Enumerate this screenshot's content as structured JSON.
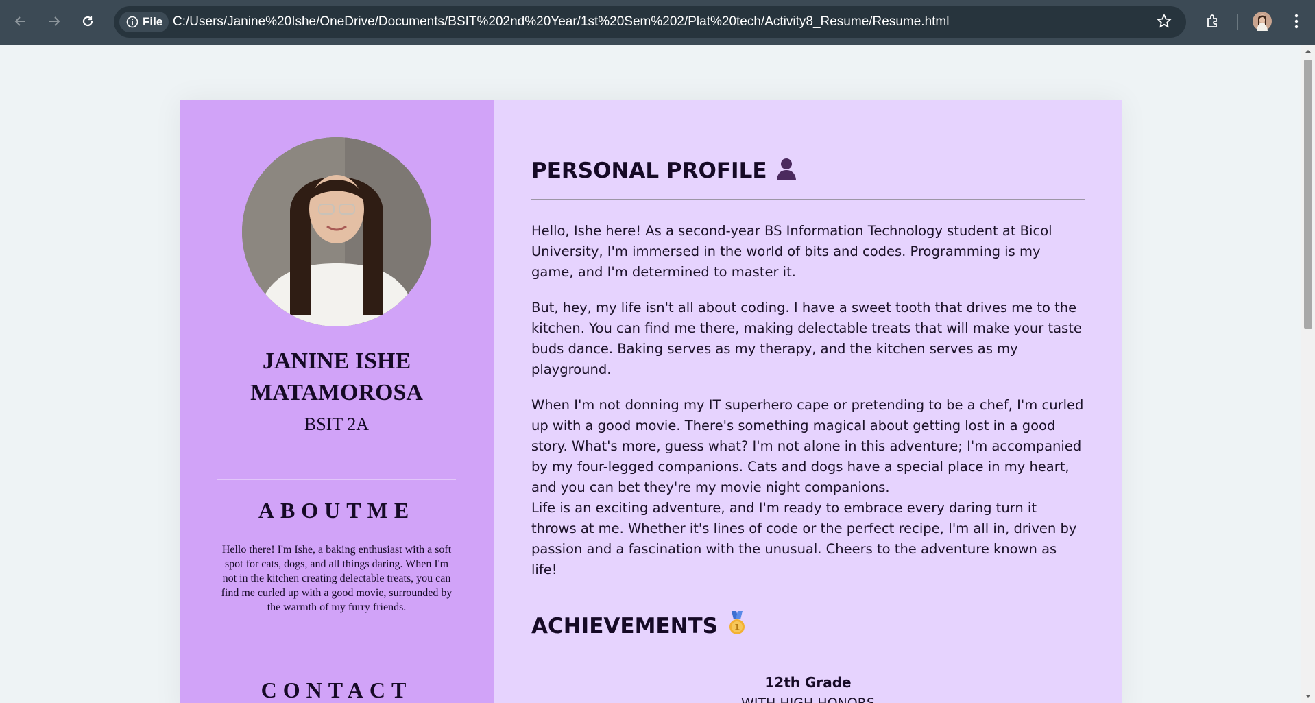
{
  "browser": {
    "site_badge": "File",
    "url": "C:/Users/Janine%20Ishe/OneDrive/Documents/BSIT%202nd%20Year/1st%20Sem%202/Plat%20tech/Activity8_Resume/Resume.html"
  },
  "sidebar": {
    "name": "JANINE ISHE MATAMOROSA",
    "section": "BSIT 2A",
    "about_heading": "ABOUTME",
    "about_text": "Hello there! I'm Ishe, a baking enthusiast with a soft spot for cats, dogs, and all things daring. When I'm not in the kitchen creating delectable treats, you can find me curled up with a good movie, surrounded by the warmth of my furry friends.",
    "contact_heading": "CONTACT"
  },
  "main": {
    "profile_heading": "PERSONAL PROFILE",
    "profile_paragraphs": [
      "Hello, Ishe here! As a second-year BS Information Technology student at Bicol University, I'm immersed in the world of bits and codes. Programming is my game, and I'm determined to master it.",
      "But, hey, my life isn't all about coding. I have a sweet tooth that drives me to the kitchen. You can find me there, making delectable treats that will make your taste buds dance. Baking serves as my therapy, and the kitchen serves as my playground.",
      "When I'm not donning my IT superhero cape or pretending to be a chef, I'm curled up with a good movie. There's something magical about getting lost in a good story. What's more, guess what? I'm not alone in this adventure; I'm accompanied by my four-legged companions. Cats and dogs have a special place in my heart, and you can bet they're my movie night companions.",
      "Life is an exciting adventure, and I'm ready to embrace every daring turn it throws at me. Whether it's lines of code or the perfect recipe, I'm all in, driven by passion and a fascination with the unusual. Cheers to the adventure known as life!"
    ],
    "achievements_heading": "ACHIEVEMENTS",
    "achievement_title": "12th Grade",
    "achievement_sub": "WITH HIGH HONORS"
  },
  "colors": {
    "sidebar_bg": "#d1a3f8",
    "main_bg": "#e6d3fe",
    "chrome_bg": "#3c4a55"
  },
  "icons": [
    "back-arrow-icon",
    "forward-arrow-icon",
    "reload-icon",
    "info-icon",
    "star-icon",
    "extensions-icon",
    "profile-avatar-icon",
    "kebab-menu-icon",
    "person-silhouette-icon",
    "medal-icon"
  ]
}
